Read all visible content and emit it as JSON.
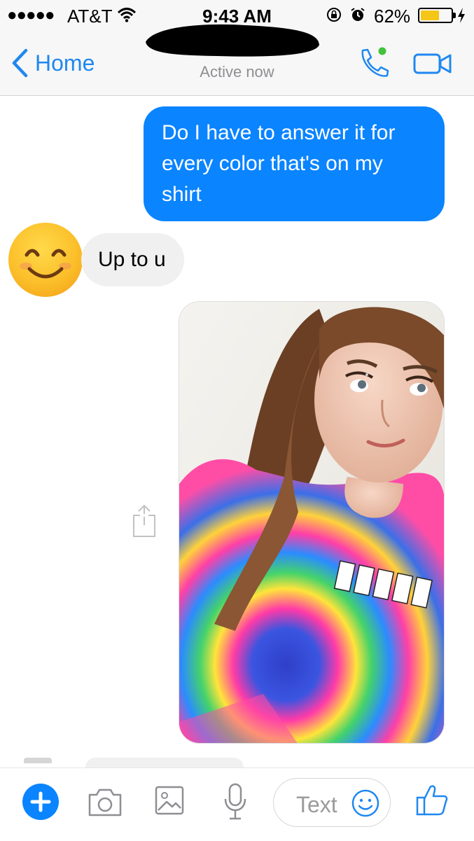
{
  "status_bar": {
    "signal": "●●●●●",
    "carrier": "AT&T",
    "time": "9:43 AM",
    "battery_percent": "62%",
    "battery_level": 0.62,
    "icons": [
      "signal-icon",
      "wifi-icon",
      "rotation-lock-icon",
      "alarm-icon",
      "battery-icon",
      "charging-icon"
    ]
  },
  "nav": {
    "back_label": "Home",
    "subtitle": "Active now",
    "icons": [
      "chevron-left-icon",
      "phone-icon",
      "video-camera-icon"
    ],
    "accent_color": "#1f88f0",
    "online_dot_color": "#42c23a"
  },
  "messages": [
    {
      "direction": "outgoing",
      "type": "text",
      "text": "Do I have to answer it for every color that's on my shirt",
      "color": "#0a84ff"
    },
    {
      "direction": "incoming",
      "type": "text",
      "text": "Up to u",
      "color": "#f1f0f0",
      "avatar": "smiling-emoji-avatar"
    },
    {
      "direction": "outgoing",
      "type": "photo",
      "content": "selfie in tie-dye shirt"
    }
  ],
  "composer": {
    "placeholder": "Text",
    "icons": [
      "plus-icon",
      "camera-icon",
      "image-icon",
      "microphone-icon",
      "emoji-icon",
      "thumbs-up-icon"
    ]
  }
}
